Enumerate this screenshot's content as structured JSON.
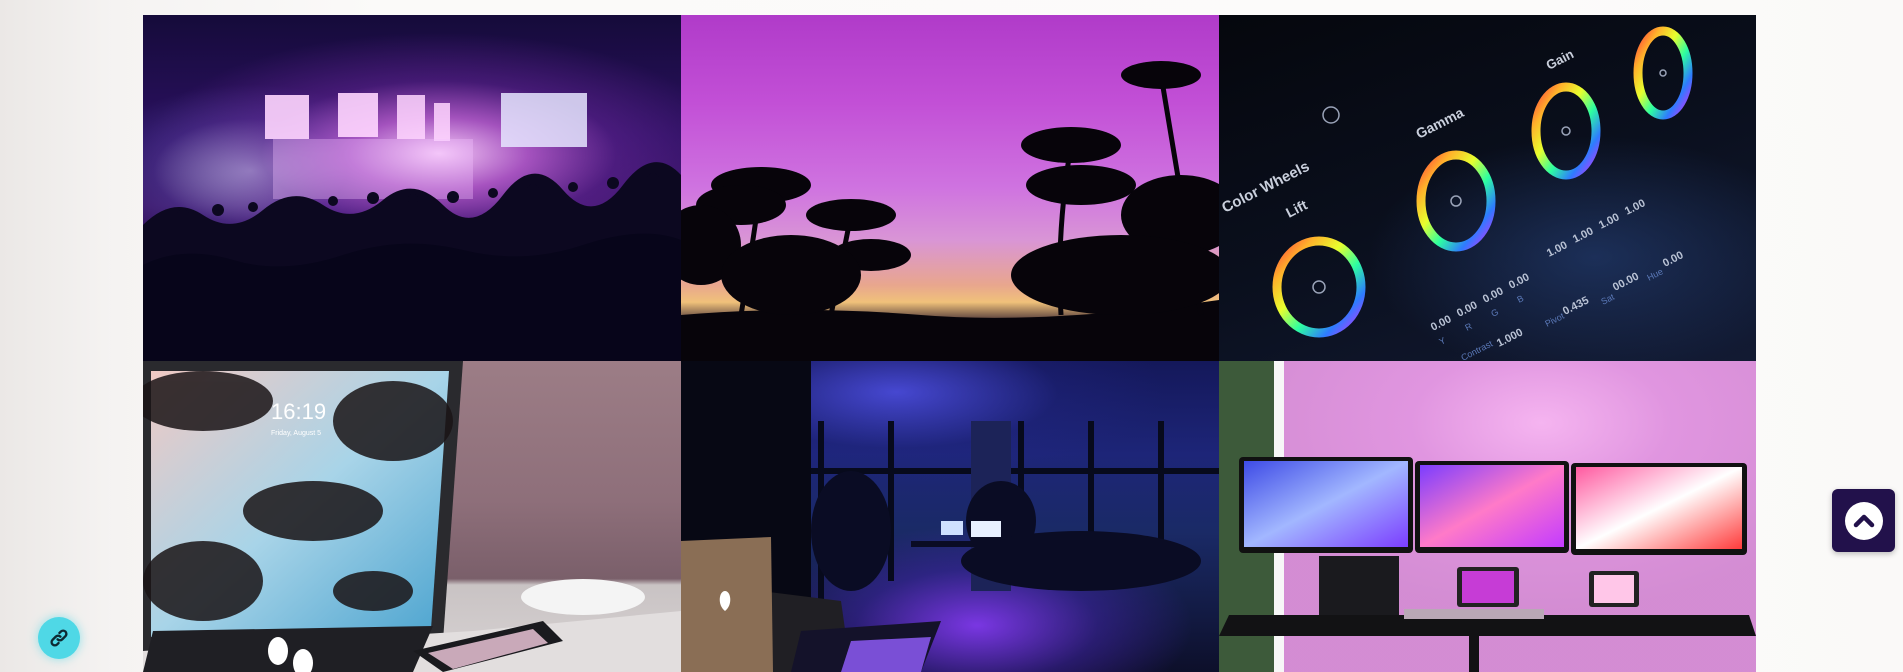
{
  "gallery": {
    "tiles": [
      {
        "icon": "concert-photo"
      },
      {
        "icon": "sunset-palms-photo"
      },
      {
        "icon": "color-wheels-photo"
      },
      {
        "icon": "tablet-desk-photo"
      },
      {
        "icon": "night-office-photo"
      },
      {
        "icon": "triple-monitor-photo"
      }
    ],
    "wheels_overlay": {
      "title": "Color Wheels",
      "labels": [
        "Lift",
        "Gamma",
        "Gain"
      ],
      "lift_values": [
        "0.00",
        "0.00",
        "0.00",
        "0.00"
      ],
      "channel_letters": [
        "Y",
        "R",
        "G",
        "B"
      ],
      "gain_values": [
        "1.00",
        "1.00",
        "1.00",
        "1.00"
      ],
      "footer_values": [
        "1.000",
        "0.435",
        "00.00",
        "0.00"
      ],
      "footer_labels": [
        "Contrast",
        "Pivot",
        "Sat",
        "Hue"
      ]
    },
    "tablet_overlay": {
      "time": "16:19",
      "date": "Friday, August 5"
    }
  },
  "controls": {
    "back_to_top_icon": "chevron-up-icon",
    "link_icon": "link-icon",
    "accent": "#22114b",
    "link_color": "#4fd8e6"
  }
}
